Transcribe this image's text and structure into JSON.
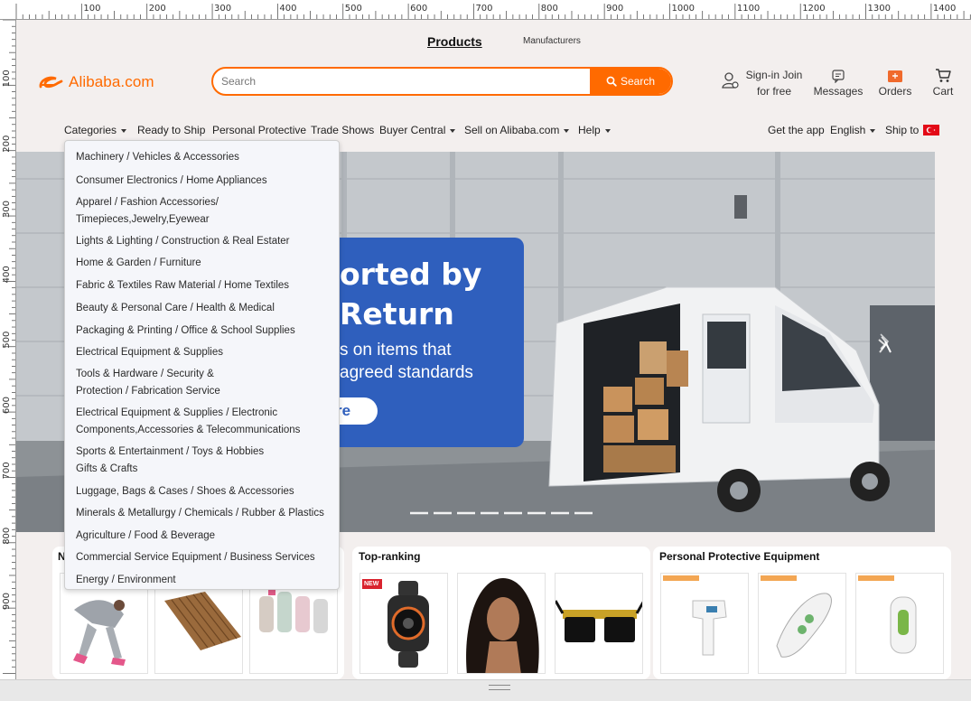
{
  "ruler": {
    "marks": [
      "100",
      "200",
      "300",
      "400",
      "500",
      "600",
      "700",
      "800",
      "900",
      "1000",
      "1100",
      "1200",
      "1300",
      "1400"
    ],
    "vmarks": [
      "100",
      "200",
      "300",
      "400",
      "500",
      "600",
      "700",
      "800",
      "900"
    ]
  },
  "top_tabs": {
    "products": "Products",
    "manufacturers": "Manufacturers"
  },
  "logo": {
    "text": "Alibaba.com"
  },
  "search": {
    "placeholder": "Search",
    "button_label": "Search"
  },
  "header_actions": {
    "sign_in": "Sign-in Join",
    "for_free": "for free",
    "messages": "Messages",
    "orders": "Orders",
    "cart": "Cart"
  },
  "nav": {
    "categories": "Categories",
    "ready_to_ship": "Ready to Ship",
    "personal_protective": "Personal Protective",
    "trade_shows": "Trade Shows",
    "buyer_central": "Buyer Central",
    "sell": "Sell on Alibaba.com",
    "help": "Help",
    "get_app": "Get the app",
    "language": "English",
    "ship_to": "Ship to"
  },
  "hero": {
    "line1": "orted by",
    "line2": "Return",
    "line3": "s on items that",
    "line4": "agreed standards",
    "button_fragment": "re"
  },
  "categories_menu": [
    [
      "Machinery / Vehicles & Accessories"
    ],
    [
      "Consumer Electronics / Home Appliances"
    ],
    [
      "Apparel / Fashion Accessories/",
      "Timepieces,Jewelry,Eyewear"
    ],
    [
      "Lights & Lighting / Construction & Real Estater"
    ],
    [
      "Home & Garden / Furniture"
    ],
    [
      "Fabric & Textiles Raw Material / Home Textiles"
    ],
    [
      "Beauty & Personal Care / Health & Medical"
    ],
    [
      "Packaging & Printing / Office & School Supplies"
    ],
    [
      "Electrical Equipment & Supplies"
    ],
    [
      "Tools & Hardware / Security &",
      "Protection / Fabrication Service"
    ],
    [
      "Electrical Equipment & Supplies / Electronic",
      "Components,Accessories & Telecommunications"
    ],
    [
      "Sports & Entertainment / Toys & Hobbies",
      "Gifts & Crafts"
    ],
    [
      "Luggage, Bags & Cases / Shoes & Accessories"
    ],
    [
      "Minerals & Metallurgy / Chemicals / Rubber & Plastics"
    ],
    [
      "Agriculture / Food & Beverage"
    ],
    [
      "Commercial Service Equipment / Business Services"
    ],
    [
      "Energy / Environment"
    ]
  ],
  "cards": {
    "card1_initial": "N",
    "top_ranking": "Top-ranking",
    "ppe": "Personal Protective Equipment",
    "new_badge": "NEW"
  },
  "colors": {
    "brand": "#ff6a00",
    "hero_panel": "#2f5fbd",
    "flag": "#e30a17"
  }
}
